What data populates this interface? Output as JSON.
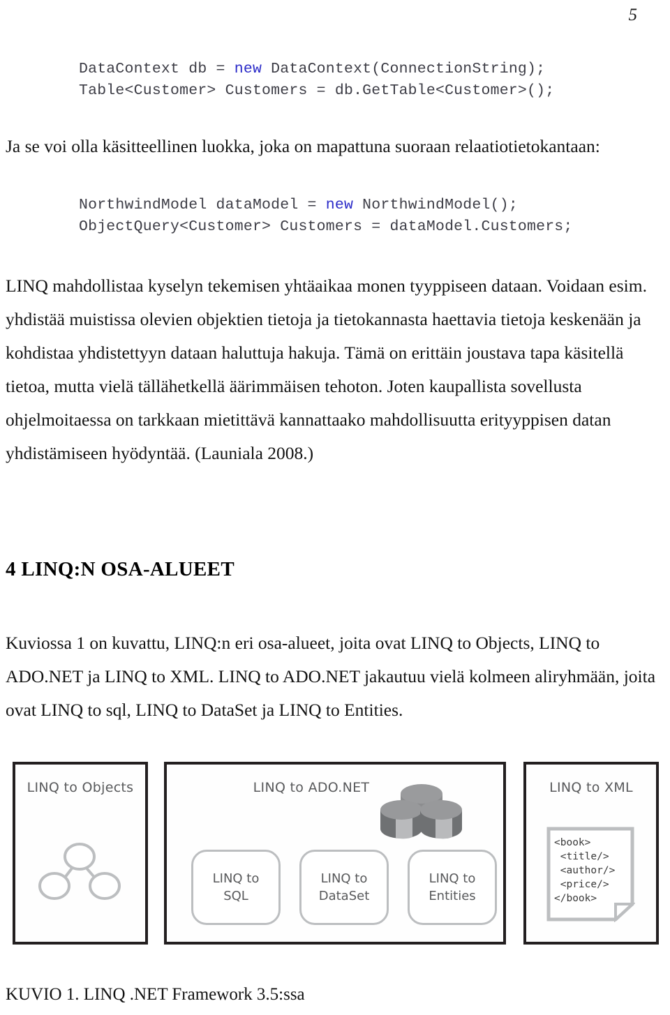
{
  "page": {
    "number": "5"
  },
  "code_blocks": [
    {
      "name": "datacontext-snippet",
      "line1_pre": "DataContext db = ",
      "line1_kw": "new",
      "line1_post": " DataContext(ConnectionString);",
      "line2": "Table<Customer> Customers = db.GetTable<Customer>();"
    },
    {
      "name": "northwindmodel-snippet",
      "line1_pre": "NorthwindModel dataModel = ",
      "line1_kw": "new",
      "line1_post": " NorthwindModel();",
      "line2": "ObjectQuery<Customer> Customers = dataModel.Customers;"
    }
  ],
  "paragraphs": {
    "intro": "Ja se voi olla käsitteellinen luokka, joka on mapattuna suoraan relaatiotietokantaan:",
    "linq_description": "LINQ mahdollistaa kyselyn tekemisen yhtäaikaa monen tyyppiseen dataan. Voidaan esim. yhdistää muistissa olevien objektien tietoja ja tietokannasta haettavia tietoja keskenään ja kohdistaa yhdistettyyn dataan haluttuja hakuja. Tämä on erittäin joustava tapa käsitellä tietoa, mutta vielä tällähetkellä äärimmäisen tehoton. Joten kaupallista sovellusta ohjelmoitaessa on tarkkaan mietittävä kannattaako mahdollisuutta erityyppisen datan yhdistämiseen hyödyntää. (Launiala 2008.)",
    "osa_alueet": "Kuviossa 1 on kuvattu, LINQ:n eri osa-alueet, joita ovat LINQ to Objects, LINQ to ADO.NET ja LINQ to XML. LINQ to ADO.NET jakautuu vielä kolmeen aliryhmään, joita ovat LINQ to sql, LINQ to DataSet ja LINQ to Entities."
  },
  "heading": {
    "text": "4 LINQ:N OSA-ALUEET"
  },
  "figure": {
    "panels": [
      {
        "id": "objects",
        "title": "LINQ to Objects",
        "icon": "object-tree-icon"
      },
      {
        "id": "adonet",
        "title": "LINQ to ADO.NET",
        "icon": "database-cylinders-icon",
        "subboxes": [
          {
            "id": "sql",
            "line1": "LINQ to",
            "line2": "SQL"
          },
          {
            "id": "dataset",
            "line1": "LINQ to",
            "line2": "DataSet"
          },
          {
            "id": "entities",
            "line1": "LINQ to",
            "line2": "Entities"
          }
        ]
      },
      {
        "id": "xml",
        "title": "LINQ to XML",
        "icon": "xml-document-icon",
        "xml_code": "<book>\n <title/>\n <author/>\n <price/>\n</book>"
      }
    ],
    "caption": "KUVIO 1. LINQ .NET Framework 3.5:ssa"
  },
  "colors": {
    "code_text": "#3d3d46",
    "code_keyword": "#2b2bc8",
    "panel_border": "#231f20",
    "diagram_gray": "#58595b",
    "subbox_border": "#bcbec0"
  }
}
